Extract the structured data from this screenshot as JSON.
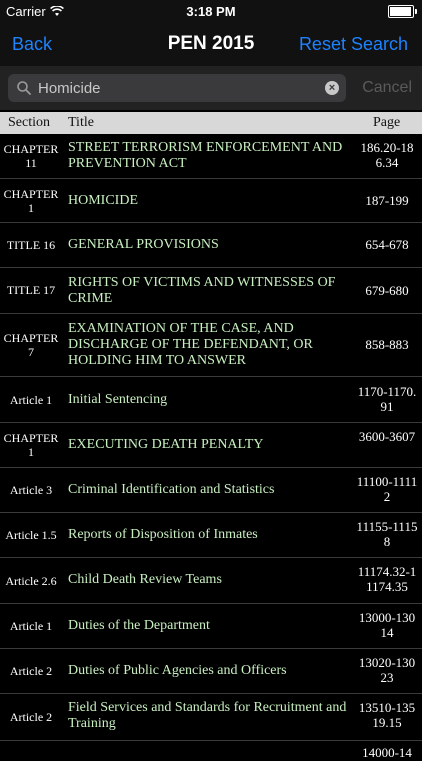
{
  "status": {
    "carrier": "Carrier",
    "time": "3:18 PM"
  },
  "nav": {
    "back": "Back",
    "title": "PEN 2015",
    "reset": "Reset Search"
  },
  "search": {
    "value": "Homicide",
    "placeholder": "Search",
    "cancel": "Cancel"
  },
  "table": {
    "headers": {
      "section": "Section",
      "title": "Title",
      "page": "Page"
    },
    "rows": [
      {
        "section": "CHAPTER 11",
        "title": "STREET TERRORISM ENFORCEMENT AND PREVENTION ACT",
        "page": "186.20-186.34"
      },
      {
        "section": "CHAPTER 1",
        "title": "HOMICIDE",
        "page": "187-199"
      },
      {
        "section": "TITLE 16",
        "title": "GENERAL PROVISIONS",
        "page": "654-678"
      },
      {
        "section": "TITLE 17",
        "title": "RIGHTS OF VICTIMS AND WITNESSES OF CRIME",
        "page": "679-680"
      },
      {
        "section": "CHAPTER 7",
        "title": "EXAMINATION OF THE CASE, AND DISCHARGE OF THE DEFENDANT, OR HOLDING HIM TO ANSWER",
        "page": "858-883"
      },
      {
        "section": "Article 1",
        "title": "Initial Sentencing",
        "page": "1170-1170.91"
      },
      {
        "section": "CHAPTER 1",
        "title": "EXECUTING DEATH PENALTY",
        "page": "3600-3607"
      },
      {
        "section": "Article 3",
        "title": "Criminal Identification and Statistics",
        "page": "11100-11112"
      },
      {
        "section": "Article 1.5",
        "title": "Reports of Disposition of Inmates",
        "page": "11155-11158"
      },
      {
        "section": "Article 2.6",
        "title": "Child Death Review Teams",
        "page": "11174.32-11174.35"
      },
      {
        "section": "Article 1",
        "title": "Duties of the Department",
        "page": "13000-13014"
      },
      {
        "section": "Article 2",
        "title": "Duties of Public Agencies and Officers",
        "page": "13020-13023"
      },
      {
        "section": "Article 2",
        "title": "Field Services and Standards for Recruitment and Training",
        "page": "13510-13519.15"
      },
      {
        "section": "",
        "title": "",
        "page": "14000-14"
      }
    ]
  }
}
